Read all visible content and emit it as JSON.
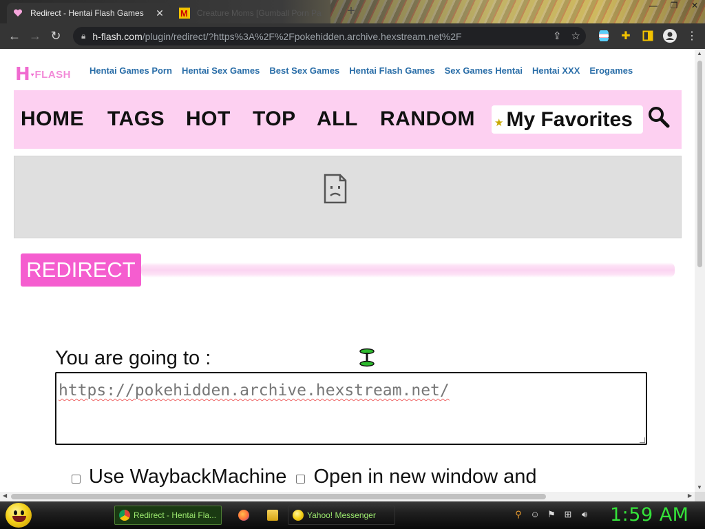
{
  "browser": {
    "tabs": [
      {
        "title": "Redirect - Hentai Flash Games",
        "active": true
      },
      {
        "title": "Creature Moms [Gumball Porn Pa",
        "active": false
      }
    ],
    "new_tab": "+",
    "url_host": "h-flash.com",
    "url_path": "/plugin/redirect/?https%3A%2F%2Fpokehidden.archive.hexstream.net%2F"
  },
  "site": {
    "logo_letter": "H",
    "logo_word": "FLASH",
    "top_links": [
      "Hentai Games Porn",
      "Hentai Sex Games",
      "Best Sex Games",
      "Hentai Flash Games",
      "Sex Games Hentai",
      "Hentai XXX",
      "Erogames"
    ],
    "menu": [
      "HOME",
      "TAGS",
      "HOT",
      "TOP",
      "ALL",
      "RANDOM"
    ],
    "favorites_label": "My Favorites"
  },
  "redirect": {
    "header": "REDIRECT",
    "prompt": "You are going to :",
    "target_url": "https://pokehidden.archive.hexstream.net/",
    "options": [
      "Use WaybackMachine",
      "Open in new window and"
    ]
  },
  "taskbar": {
    "tasks": [
      "Redirect - Hentai Fla...",
      "Yahoo! Messenger"
    ],
    "clock": "1:59 AM"
  },
  "colors": {
    "brand_pink": "#f55dcf",
    "menu_bg": "#fdd0f1",
    "link_blue": "#2a6ea8",
    "clock_green": "#35e23a"
  }
}
